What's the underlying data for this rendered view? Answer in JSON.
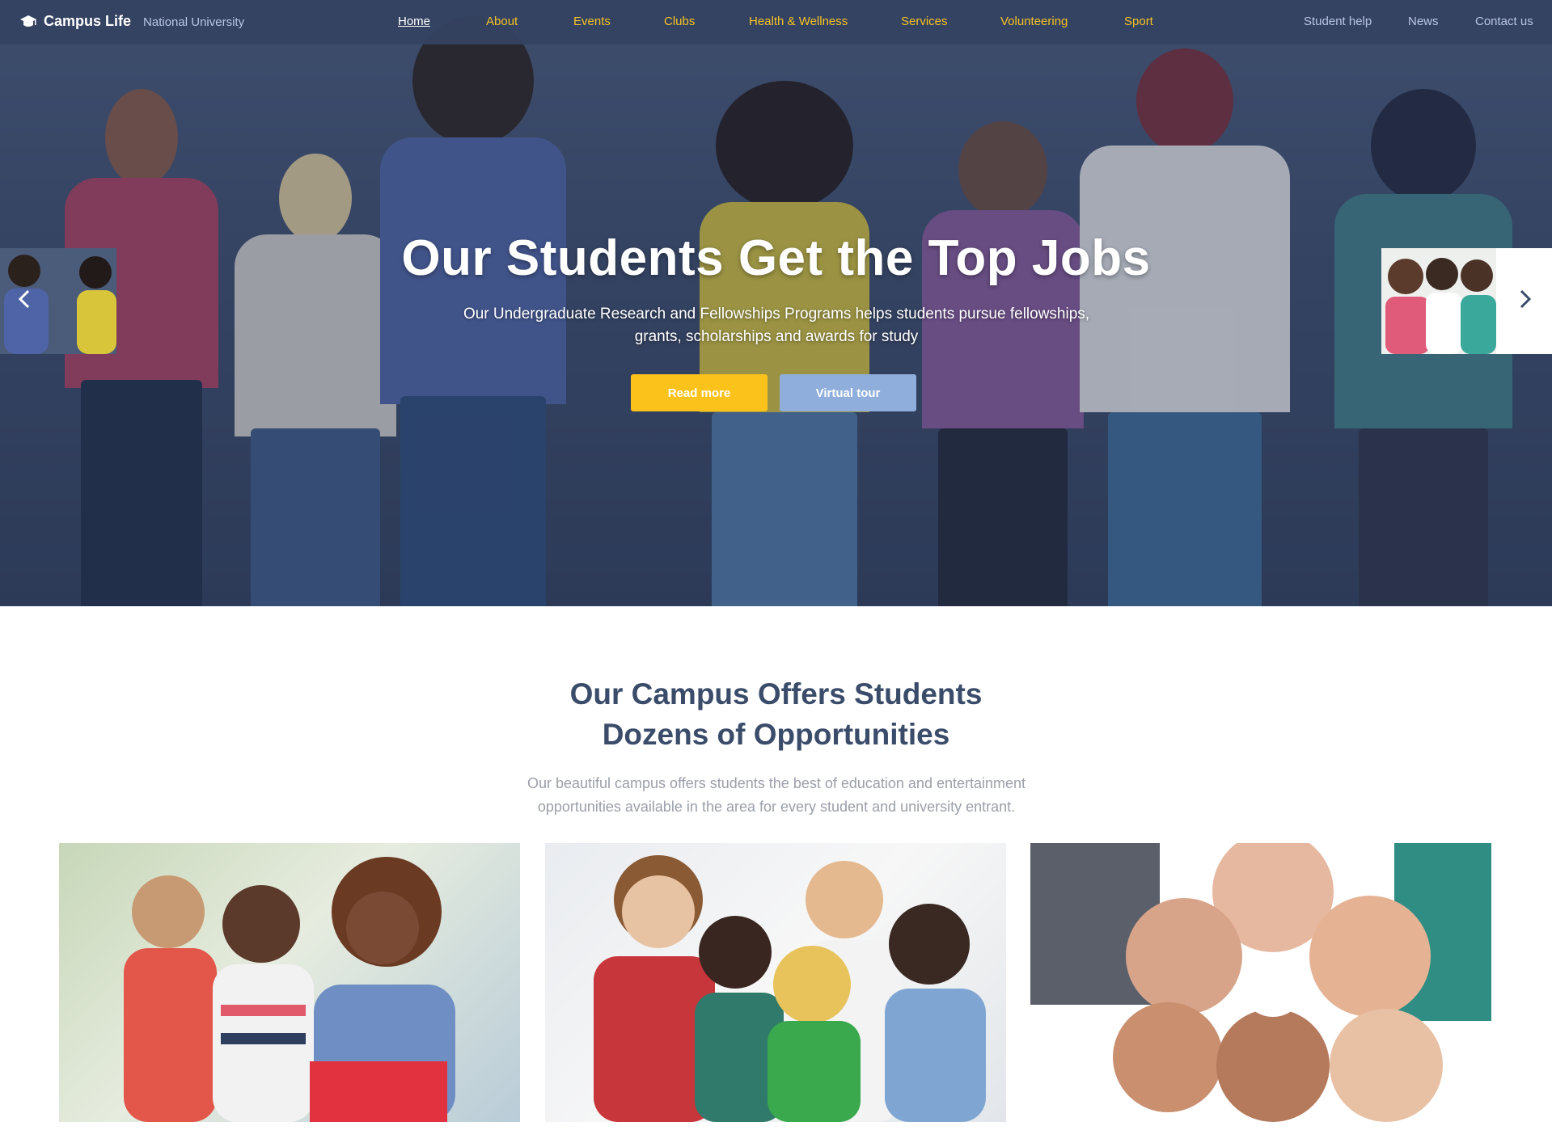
{
  "brand": {
    "name": "Campus Life",
    "subtitle": "National University",
    "icon": "graduation-cap-icon"
  },
  "nav": {
    "main": [
      "Home",
      "About",
      "Events",
      "Clubs",
      "Health & Wellness",
      "Services",
      "Volunteering",
      "Sport"
    ],
    "active": "Home",
    "right": [
      "Student help",
      "News",
      "Contact us"
    ]
  },
  "hero": {
    "title": "Our Students Get the Top Jobs",
    "text": "Our Undergraduate Research and Fellowships Programs helps students pursue fellowships, grants, scholarships and awards for study",
    "primary_button": "Read more",
    "secondary_button": "Virtual tour",
    "prev_icon": "chevron-left-icon",
    "next_icon": "chevron-right-icon"
  },
  "section": {
    "title_line1": "Our Campus Offers Students",
    "title_line2": "Dozens of Opportunities",
    "text": "Our beautiful campus offers students the best of education and entertainment opportunities available in the area for every student and university entrant."
  },
  "colors": {
    "header_bg": "#344262",
    "accent": "#fcc21c",
    "secondary": "#8faedb",
    "heading": "#3a4c6a",
    "muted_text": "#9a9fa8"
  }
}
